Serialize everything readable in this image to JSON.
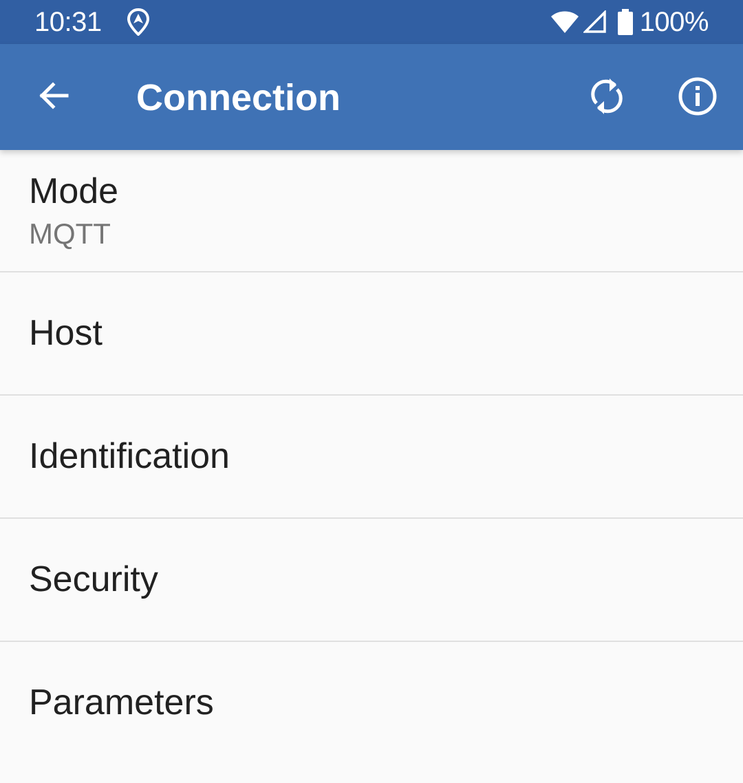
{
  "status_bar": {
    "time": "10:31",
    "battery": "100%",
    "icons": [
      "location-icon",
      "wifi-icon",
      "signal-icon",
      "battery-icon"
    ]
  },
  "app_bar": {
    "title": "Connection",
    "back_icon": "arrow-back-icon",
    "actions": [
      "refresh-icon",
      "info-icon"
    ],
    "background_color": "#3f72b5",
    "status_bar_color": "#315fa3"
  },
  "preferences": [
    {
      "title": "Mode",
      "summary": "MQTT"
    },
    {
      "title": "Host"
    },
    {
      "title": "Identification"
    },
    {
      "title": "Security"
    },
    {
      "title": "Parameters"
    }
  ]
}
